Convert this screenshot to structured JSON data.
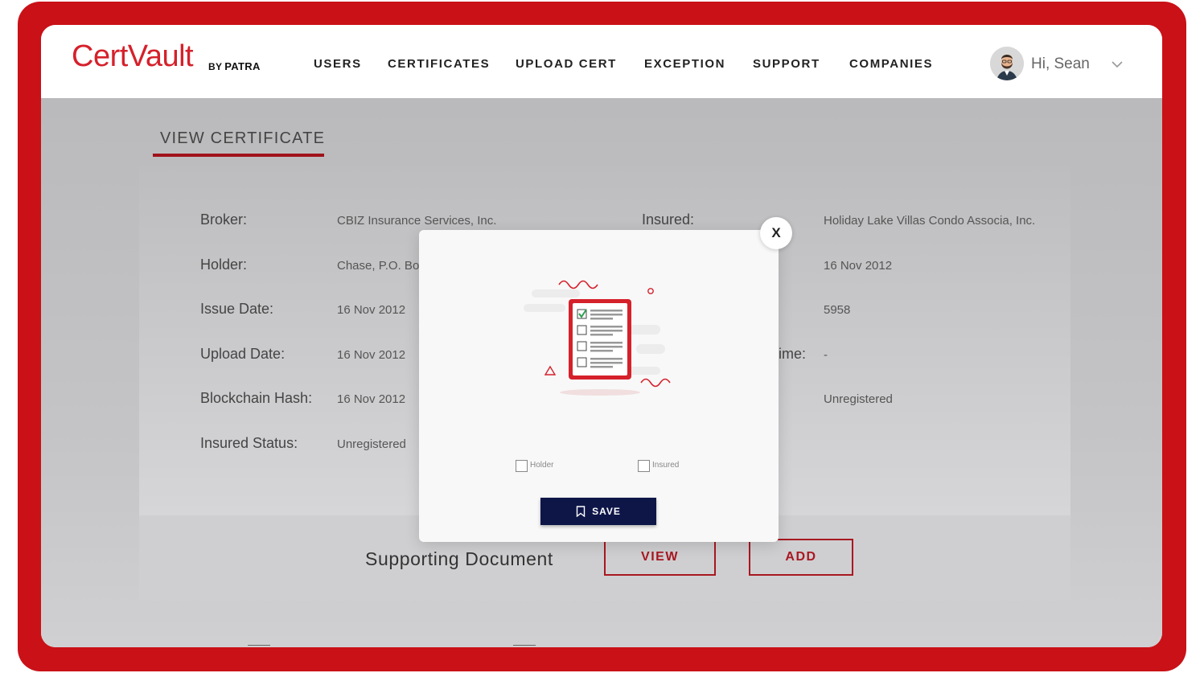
{
  "brand": {
    "name": "CertVault",
    "by": "BY",
    "company": "PATRA"
  },
  "nav": [
    "USERS",
    "CERTIFICATES",
    "UPLOAD CERT",
    "EXCEPTION",
    "SUPPORT",
    "COMPANIES"
  ],
  "user": {
    "greeting": "Hi, Sean"
  },
  "page": {
    "title": "VIEW CERTIFICATE"
  },
  "details_left": [
    {
      "label": "Broker:",
      "value": "CBIZ Insurance Services, Inc."
    },
    {
      "label": "Holder:",
      "value": "Chase, P.O. Bo"
    },
    {
      "label": "Issue Date:",
      "value": "16 Nov 2012"
    },
    {
      "label": "Upload Date:",
      "value": "16 Nov 2012"
    },
    {
      "label": "Blockchain Hash:",
      "value": "16 Nov 2012"
    },
    {
      "label": "Insured Status:",
      "value": "Unregistered"
    }
  ],
  "details_right": [
    {
      "label": "Insured:",
      "value": "Holiday Lake Villas Condo Associa, Inc."
    },
    {
      "label": "",
      "value": "16 Nov 2012"
    },
    {
      "label": "",
      "value": "5958"
    },
    {
      "label": "ime:",
      "value": "-"
    },
    {
      "label": "",
      "value": "Unregistered"
    }
  ],
  "supporting": {
    "label": "Supporting Document",
    "view": "VIEW",
    "add": "ADD"
  },
  "modal": {
    "close": "X",
    "options": [
      {
        "label": "Holder"
      },
      {
        "label": "Insured"
      }
    ],
    "save": "SAVE"
  },
  "colors": {
    "brand_red": "#c91117",
    "navy": "#0e1648",
    "accent_red": "#a81820"
  }
}
